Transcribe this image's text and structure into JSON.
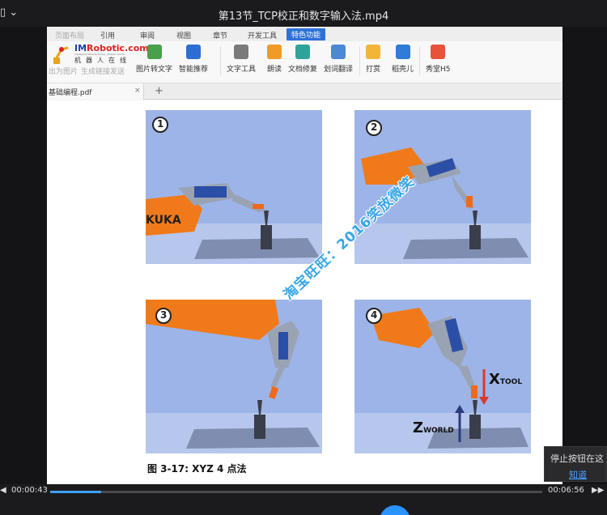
{
  "window": {
    "title": "第13节_TCP校正和数字输入法.mp4",
    "menu_glyph": "▯",
    "menu_arrow": "⌄"
  },
  "ribbon": {
    "tabs": [
      "页面布局",
      "引用",
      "审阅",
      "视图",
      "章节",
      "开发工具",
      "特色功能"
    ],
    "active_tab": "特色功能"
  },
  "toolbar": {
    "logo_text": "IM",
    "logo_brand": "Robotic.com",
    "logo_tagline": "Intelligent Manufacturing · Robotic Online",
    "logo_cn": "机器人在线",
    "faded_left": "出为图片",
    "faded_mid": "生成链接发送",
    "tools": [
      {
        "label": "图片转文字",
        "icon": "image-to-text-icon"
      },
      {
        "label": "智能推荐",
        "icon": "smart-recommend-icon"
      },
      {
        "label": "文字工具",
        "icon": "text-tools-icon"
      },
      {
        "label": "朗读",
        "icon": "read-aloud-icon"
      },
      {
        "label": "文档修复",
        "icon": "document-repair-icon"
      },
      {
        "label": "划词翻译",
        "icon": "translate-icon"
      },
      {
        "label": "打赏",
        "icon": "reward-icon"
      },
      {
        "label": "稻壳儿",
        "icon": "docer-icon"
      },
      {
        "label": "秀堂H5",
        "icon": "xiutang-icon"
      }
    ]
  },
  "document": {
    "tab_name": "基础编程.pdf",
    "tab_close": "×",
    "new_tab": "+",
    "panel_numbers": [
      "1",
      "2",
      "3",
      "4"
    ],
    "kuka_label": "KUKA",
    "x_tool_label": "X",
    "x_tool_sub": "TOOL",
    "z_world_label": "Z",
    "z_world_sub": "WORLD",
    "caption": "图 3-17: XYZ 4 点法",
    "watermark": "淘宝旺旺：2016笑放微笑"
  },
  "tooltip": {
    "text": "停止按钮在这",
    "link": "知道"
  },
  "player": {
    "current_time": "00:00:43",
    "total_time": "00:06:56",
    "progress_fraction": 0.104,
    "prev_glyph": "◀",
    "next_glyph": "▶▶",
    "accent": "#2b93ff"
  }
}
